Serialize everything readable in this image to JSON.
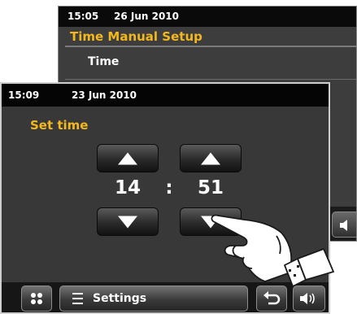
{
  "back_screen": {
    "status": {
      "time": "15:05",
      "date": "26 Jun 2010"
    },
    "title": "Time Manual Setup",
    "menu_item": "Time"
  },
  "front_screen": {
    "status": {
      "time": "15:09",
      "date": "23 Jun 2010"
    },
    "title": "Set time",
    "time_setting": {
      "hours": "14",
      "separator": ":",
      "minutes": "51"
    },
    "bottom_bar": {
      "settings_label": "Settings"
    }
  },
  "icons": [
    "grid-icon",
    "menu-list-icon",
    "back-arrow-icon",
    "volume-icon",
    "pointing-hand-icon"
  ],
  "colors": {
    "title_accent": "#f2b81e",
    "status_bar": "#050505",
    "screen_bg": "#383838"
  }
}
